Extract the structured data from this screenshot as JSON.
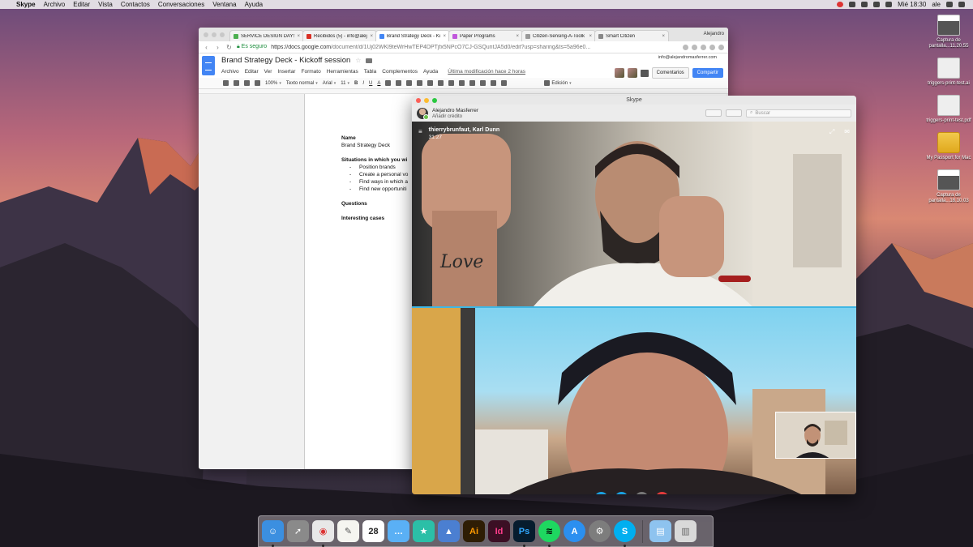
{
  "menubar": {
    "apple": "",
    "items": [
      "Skype",
      "Archivo",
      "Editar",
      "Vista",
      "Contactos",
      "Conversaciones",
      "Ventana",
      "Ayuda"
    ],
    "clock": "Mié 18:30",
    "user": "ale"
  },
  "desktop": {
    "icons": [
      {
        "label": "Captura de pantalla...11.20.55",
        "kind": "screenshot"
      },
      {
        "label": "triggers-print-test.ai",
        "kind": "file"
      },
      {
        "label": "triggers-print-test.pdf",
        "kind": "file"
      },
      {
        "label": "My Passport for Mac",
        "kind": "drive"
      },
      {
        "label": "Captura de pantalla...18.10.03",
        "kind": "screenshot"
      }
    ]
  },
  "browser": {
    "tabs": [
      {
        "title": "SERVICE DESIGN DAYS",
        "color": "#4caf50"
      },
      {
        "title": "Recibidos (5) - info@alejo",
        "color": "#d93025"
      },
      {
        "title": "Brand Strategy Deck - Ki",
        "color": "#4285f4",
        "active": true
      },
      {
        "title": "Paper Programs",
        "color": "#c158dc"
      },
      {
        "title": "Citizen-Sensing-A-Toolk",
        "color": "#999999"
      },
      {
        "title": "Smart Citizen",
        "color": "#888888"
      }
    ],
    "tab_close": "×",
    "user": "Alejandro",
    "secure_label": "Es seguro",
    "url_host": "https://docs.google.com",
    "url_path": "/document/d/1Uj02WKl9teWrHwTEP4DPTjfx5NPcO7CJ-GSQuntJA5d0/edit?usp=sharing&ts=5a96e0..."
  },
  "docs": {
    "title": "Brand Strategy Deck - Kickoff session",
    "star": "☆",
    "menu": [
      "Archivo",
      "Editar",
      "Ver",
      "Insertar",
      "Formato",
      "Herramientas",
      "Tabla",
      "Complementos",
      "Ayuda"
    ],
    "last_modified": "Última modificación hace 2 horas",
    "email": "info@alejandromasferrer.com",
    "comments_label": "Comentarios",
    "share_label": "Compartir",
    "toolbar": {
      "zoom": "100%",
      "style": "Texto normal",
      "font": "Arial",
      "size": "11",
      "bold": "B",
      "italic": "I",
      "underline": "U",
      "textcolor": "A",
      "mode": "Edición"
    },
    "content": {
      "name_heading": "Name",
      "name_value": "Brand Strategy Deck",
      "situations_heading": "Situations in which you wi",
      "bullets": [
        "Position brands",
        "Create a personal vo",
        "Find ways in which a",
        "Find new opportuniti"
      ],
      "questions_heading": "Questions",
      "cases_heading": "Interesting cases"
    }
  },
  "skype": {
    "window_title": "Skype",
    "user_name": "Alejandro Masferrer",
    "user_credit": "Añadir crédito",
    "search_placeholder": "Buscar",
    "call": {
      "participants": "thierrybrunfaut, Karl Dunn",
      "duration": "31:27"
    },
    "controls": [
      {
        "name": "video",
        "color": "#1aa1e1",
        "glyph": "■"
      },
      {
        "name": "mic",
        "color": "#1aa1e1",
        "glyph": "●"
      },
      {
        "name": "add",
        "color": "#777777",
        "glyph": "+"
      },
      {
        "name": "hangup",
        "color": "#e23b3b",
        "glyph": "✆"
      }
    ]
  },
  "dock": {
    "apps": [
      {
        "name": "finder",
        "color": "#3b8fe0",
        "glyph": "☺"
      },
      {
        "name": "launchpad",
        "color": "#8a8a8a",
        "glyph": "➚"
      },
      {
        "name": "chrome",
        "color": "#e8e8e8",
        "glyph": "◉"
      },
      {
        "name": "textedit",
        "color": "#f5f5f0",
        "glyph": "✎"
      },
      {
        "name": "calendar",
        "color": "#ffffff",
        "glyph": "28"
      },
      {
        "name": "messages",
        "color": "#5ab0f5",
        "glyph": "…"
      },
      {
        "name": "superstar",
        "color": "#2bbfa7",
        "glyph": "★"
      },
      {
        "name": "keynote",
        "color": "#4b7fd1",
        "glyph": "▲"
      },
      {
        "name": "illustrator",
        "color": "#2e1d04",
        "glyph": "Ai"
      },
      {
        "name": "indesign",
        "color": "#3b0f24",
        "glyph": "Id"
      },
      {
        "name": "photoshop",
        "color": "#061c2e",
        "glyph": "Ps"
      },
      {
        "name": "spotify",
        "color": "#1ed760",
        "glyph": "≋"
      },
      {
        "name": "appstore",
        "color": "#2b8ff0",
        "glyph": "A"
      },
      {
        "name": "systemprefs",
        "color": "#7d7d7d",
        "glyph": "⚙"
      },
      {
        "name": "skype",
        "color": "#00aff0",
        "glyph": "S"
      }
    ],
    "trailing": [
      {
        "name": "downloads-folder",
        "color": "#8ec3ef",
        "glyph": "▤"
      },
      {
        "name": "trash",
        "color": "#d9d9d9",
        "glyph": "▥"
      }
    ]
  }
}
